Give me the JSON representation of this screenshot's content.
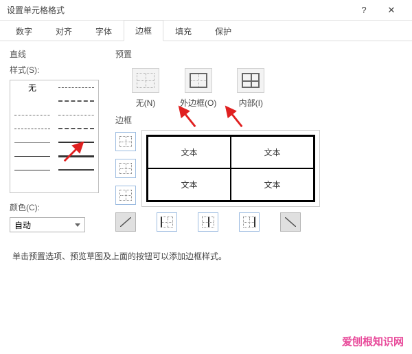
{
  "window": {
    "title": "设置单元格格式",
    "help_btn": "?",
    "close_btn": "✕"
  },
  "tabs": {
    "items": [
      {
        "label": "数字"
      },
      {
        "label": "对齐"
      },
      {
        "label": "字体"
      },
      {
        "label": "边框"
      },
      {
        "label": "填充"
      },
      {
        "label": "保护"
      }
    ],
    "active_index": 3
  },
  "line": {
    "section": "直线",
    "style_label": "样式(S):",
    "none_label": "无",
    "color_label": "颜色(C):",
    "color_value": "自动"
  },
  "presets": {
    "section": "预置",
    "items": [
      {
        "label": "无(N)"
      },
      {
        "label": "外边框(O)"
      },
      {
        "label": "内部(I)"
      }
    ]
  },
  "border": {
    "section": "边框",
    "cell_text": "文本"
  },
  "help_text": "单击预置选项、预览草图及上面的按钮可以添加边框样式。",
  "watermark": "爱刨根知识网"
}
